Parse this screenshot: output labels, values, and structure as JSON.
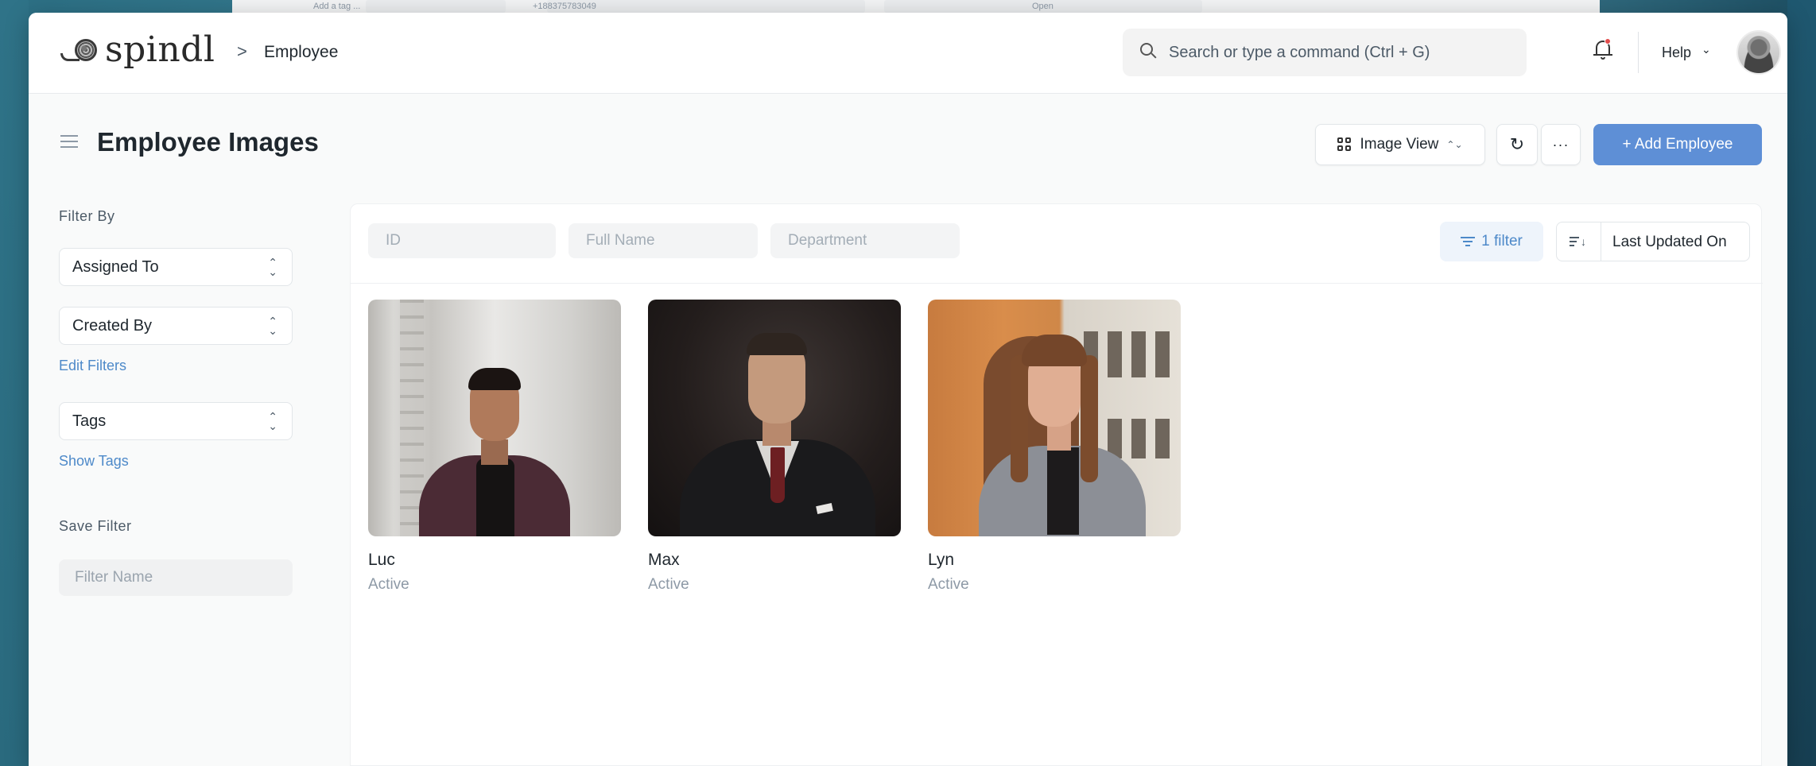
{
  "background_window": {
    "tag_text": "Add a tag ...",
    "phone_text": "+188375783049",
    "status_text": "Open"
  },
  "navbar": {
    "brand": "spindl",
    "breadcrumb_separator": ">",
    "breadcrumb": "Employee",
    "search_placeholder": "Search or type a command (Ctrl + G)",
    "help_label": "Help",
    "help_chevron": "⌄"
  },
  "page": {
    "title": "Employee Images",
    "view_button": "Image View",
    "view_chevron": "⌃⌄",
    "refresh_icon": "↻",
    "more_label": "···",
    "add_button": "+ Add Employee",
    "accent_color": "#5e8fd6"
  },
  "sidebar": {
    "filter_by_label": "Filter By",
    "assigned_to": "Assigned To",
    "created_by": "Created By",
    "edit_filters": "Edit Filters",
    "tags": "Tags",
    "show_tags": "Show Tags",
    "save_filter_label": "Save Filter",
    "filter_name_placeholder": "Filter Name"
  },
  "list": {
    "id_placeholder": "ID",
    "full_name_placeholder": "Full Name",
    "department_placeholder": "Department",
    "filter_button": "1 filter",
    "sort_label": "Last Updated On",
    "employees": [
      {
        "name": "Luc",
        "status": "Active"
      },
      {
        "name": "Max",
        "status": "Active"
      },
      {
        "name": "Lyn",
        "status": "Active"
      }
    ]
  }
}
